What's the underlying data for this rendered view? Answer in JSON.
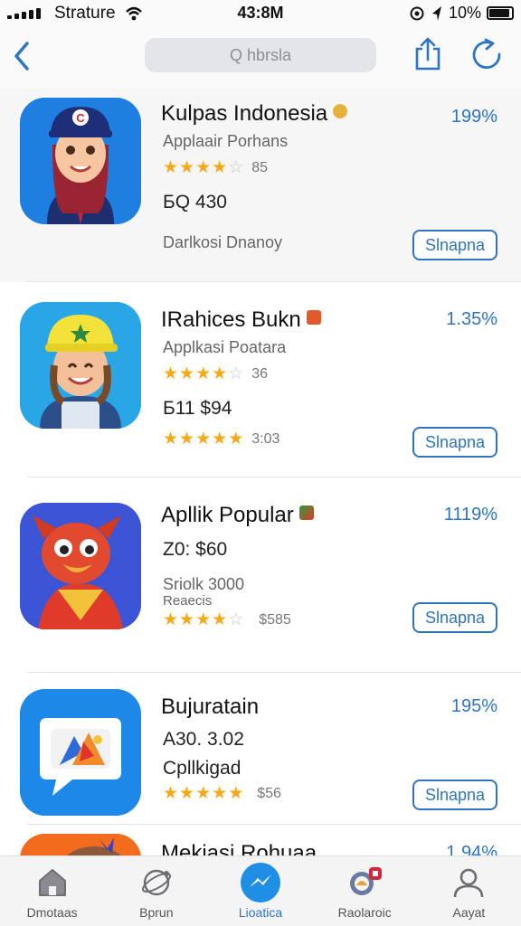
{
  "status": {
    "carrier": "Strature",
    "time": "43:8M",
    "battery": "10%"
  },
  "nav": {
    "search_placeholder": "Q hbrsla",
    "icons": [
      "chevron-left-icon",
      "share-icon",
      "refresh-icon"
    ]
  },
  "apps": [
    {
      "title": "Kulpas Indonesia",
      "percent": "199%",
      "lines": [
        "Applaair Porhans",
        "БQ 430",
        "Darlkosi Dnanoy"
      ],
      "rating_count": "85",
      "button": "Slnapna"
    },
    {
      "title": "IRahices Bukn",
      "percent": "1.35%",
      "lines": [
        "Applkasi Poatara",
        "Б11 $94"
      ],
      "rating_count": "36",
      "rating_count_2": "3:03",
      "button": "Slnapna"
    },
    {
      "title": "Apllik Popular",
      "percent": "1119%",
      "lines": [
        "Z0: $60",
        "Sriolk 3000",
        "Reaecis"
      ],
      "rating_count": "$585",
      "button": "Slnapna"
    },
    {
      "title": "Bujuratain",
      "percent": "195%",
      "lines": [
        "A30. 3.02",
        "Cpllkigad"
      ],
      "rating_count": "$56",
      "button": "Slnapna"
    },
    {
      "title": "Mekiasi Rohuaa",
      "percent": "1.94%"
    }
  ],
  "tabs": [
    {
      "label": "Dmotaas",
      "icon": "home-icon"
    },
    {
      "label": "Bprun",
      "icon": "globe-icon"
    },
    {
      "label": "Lioatica",
      "icon": "messenger-icon"
    },
    {
      "label": "Raolaroic",
      "icon": "search-notification-icon"
    },
    {
      "label": "Aayat",
      "icon": "profile-icon"
    }
  ],
  "colors": {
    "accent": "#2e74c4",
    "star": "#f6a914"
  }
}
